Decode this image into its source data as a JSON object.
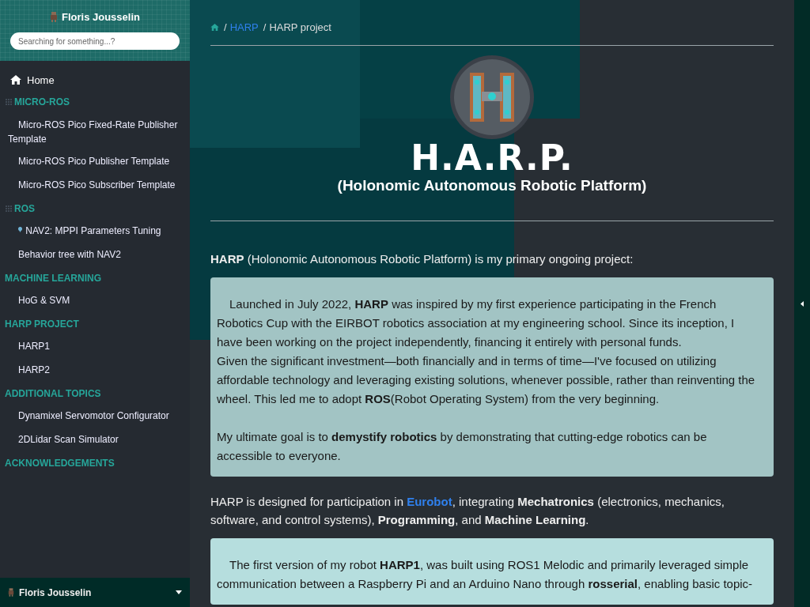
{
  "sidebar": {
    "site_title": "Floris Jousselin",
    "search": {
      "placeholder": "Searching for something...?"
    },
    "items": [
      {
        "kind": "home",
        "label": "Home",
        "has_icon": true
      },
      {
        "kind": "section",
        "label": "MICRO-ROS",
        "has_icon": true
      },
      {
        "kind": "link",
        "label": "Micro-ROS Pico Fixed-Rate Publisher Template",
        "has_icon": false
      },
      {
        "kind": "link",
        "label": "Micro-ROS Pico Publisher Template",
        "has_icon": false
      },
      {
        "kind": "link",
        "label": "Micro-ROS Pico Subscriber Template",
        "has_icon": false
      },
      {
        "kind": "section",
        "label": "ROS",
        "has_icon": true
      },
      {
        "kind": "link",
        "label": "NAV2: MPPI Parameters Tuning",
        "has_icon": true
      },
      {
        "kind": "link",
        "label": "Behavior tree with NAV2",
        "has_icon": false
      },
      {
        "kind": "section",
        "label": "MACHINE LEARNING",
        "has_icon": false
      },
      {
        "kind": "link",
        "label": "HoG & SVM",
        "has_icon": false
      },
      {
        "kind": "section",
        "label": "HARP PROJECT",
        "has_icon": false
      },
      {
        "kind": "link",
        "label": "HARP1",
        "has_icon": false
      },
      {
        "kind": "link",
        "label": "HARP2",
        "has_icon": false
      },
      {
        "kind": "section",
        "label": "ADDITIONAL TOPICS",
        "has_icon": false
      },
      {
        "kind": "link",
        "label": "Dynamixel Servomotor Configurator",
        "has_icon": false
      },
      {
        "kind": "link",
        "label": "2DLidar Scan Simulator",
        "has_icon": false
      },
      {
        "kind": "section",
        "label": "ACKNOWLEDGEMENTS",
        "has_icon": false
      }
    ],
    "footer": {
      "label": "Floris Jousselin"
    }
  },
  "breadcrumb": [
    {
      "separator": "/",
      "label": "HARP",
      "link": true
    },
    {
      "separator": "/",
      "label": "HARP project",
      "link": false
    }
  ],
  "hero": {
    "title": "H.A.R.P.",
    "subtitle": "(Holonomic Autonomous Robotic Platform)"
  },
  "content": [
    {
      "kind": "paragraph",
      "text": "**HARP** (Holonomic Autonomous Robotic Platform) is my primary ongoing project:"
    },
    {
      "kind": "callout",
      "color": "#a2c4c4",
      "paragraphs": [
        "Launched in July 2022, **HARP** was inspired by my first experience participating in the French Robotics Cup with the EIRBOT robotics association at my engineering school. Since its inception, I have been working on the project independently, financing it entirely with personal funds.",
        "Given the significant investment—both financially and in terms of time—I've focused on utilizing affordable technology and leveraging existing solutions, whenever possible, rather than reinventing the wheel. This led me to adopt **ROS**(Robot Operating System) from the very beginning.",
        "My ultimate goal is to **demystify robotics** by demonstrating that cutting-edge robotics can be accessible to everyone."
      ]
    },
    {
      "kind": "link_paragraph",
      "before": "HARP is designed for participation in ",
      "link": "Eurobot",
      "after": ", integrating **Mechatronics** (electronics, mechanics, software, and control systems), **Programming**, and **Machine Learning**."
    },
    {
      "kind": "callout",
      "color": "#b6dede",
      "paragraphs": [
        "The first version of my robot **HARP1**, was built using ROS1 Melodic and primarily leveraged simple communication between a Raspberry Pi and an Arduino Nano through **rosserial**, enabling basic topic-"
      ]
    }
  ]
}
